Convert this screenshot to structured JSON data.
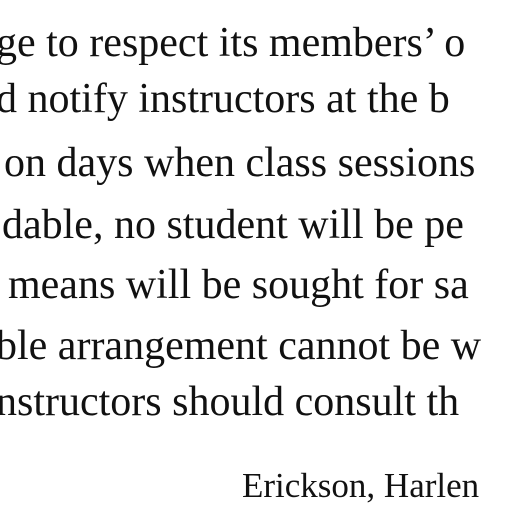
{
  "document": {
    "lines": [
      "ge to respect its members’ o",
      "d notify instructors at the b",
      "on days when class sessions",
      "dable, no student will be pe",
      "means will be sought for sa",
      "ble arrangement cannot be w",
      "nstructors should consult th"
    ],
    "signature": "Erickson, Harlen"
  }
}
